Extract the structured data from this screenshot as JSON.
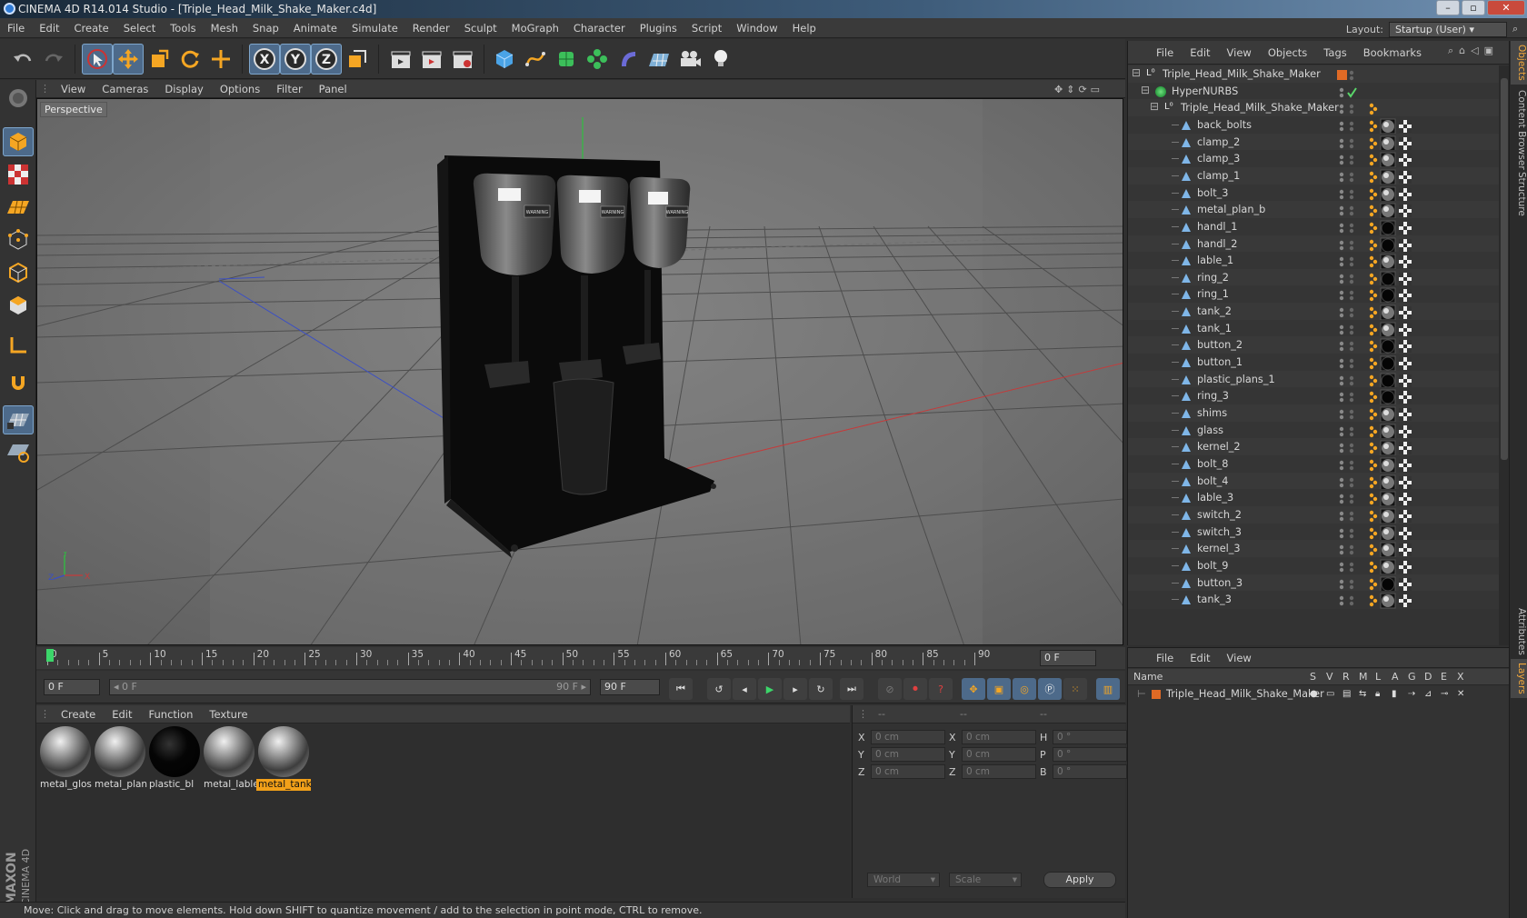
{
  "window": {
    "title": "CINEMA 4D R14.014 Studio - [Triple_Head_Milk_Shake_Maker.c4d]"
  },
  "menubar": [
    "File",
    "Edit",
    "Create",
    "Select",
    "Tools",
    "Mesh",
    "Snap",
    "Animate",
    "Simulate",
    "Render",
    "Sculpt",
    "MoGraph",
    "Character",
    "Plugins",
    "Script",
    "Window",
    "Help"
  ],
  "layout": {
    "label": "Layout:",
    "value": "Startup (User)"
  },
  "viewport": {
    "menu": [
      "View",
      "Cameras",
      "Display",
      "Options",
      "Filter",
      "Panel"
    ],
    "label": "Perspective",
    "axis": {
      "x": "X",
      "y": "Y",
      "z": "Z"
    },
    "warning_labels": [
      "WARNING",
      "WARNING",
      "WARNING"
    ]
  },
  "timeline": {
    "ticks": [
      "0",
      "5",
      "10",
      "15",
      "20",
      "25",
      "30",
      "35",
      "40",
      "45",
      "50",
      "55",
      "60",
      "65",
      "70",
      "75",
      "80",
      "85",
      "90"
    ],
    "current_frame": "0 F",
    "start_frame": "0 F",
    "range_start": "0 F",
    "range_end": "90 F",
    "end_frame": "90 F"
  },
  "material_manager": {
    "menu": [
      "Create",
      "Edit",
      "Function",
      "Texture"
    ],
    "materials": [
      {
        "name": "metal_glos",
        "selected": false,
        "kind": "metal"
      },
      {
        "name": "metal_plan",
        "selected": false,
        "kind": "metal"
      },
      {
        "name": "plastic_bl",
        "selected": false,
        "kind": "black"
      },
      {
        "name": "metal_lable",
        "selected": false,
        "kind": "metal"
      },
      {
        "name": "metal_tank",
        "selected": true,
        "kind": "metal"
      }
    ]
  },
  "coordinates": {
    "header": [
      "--",
      "--",
      "--"
    ],
    "rows": [
      {
        "a": "X",
        "av": "0 cm",
        "b": "X",
        "bv": "0 cm",
        "c": "H",
        "cv": "0 °"
      },
      {
        "a": "Y",
        "av": "0 cm",
        "b": "Y",
        "bv": "0 cm",
        "c": "P",
        "cv": "0 °"
      },
      {
        "a": "Z",
        "av": "0 cm",
        "b": "Z",
        "bv": "0 cm",
        "c": "B",
        "cv": "0 °"
      }
    ],
    "space": "World",
    "mode": "Scale",
    "apply": "Apply"
  },
  "status": "Move: Click and drag to move elements. Hold down SHIFT to quantize movement / add to the selection in point mode, CTRL to remove.",
  "objects_panel": {
    "menu": [
      "File",
      "Edit",
      "View",
      "Objects",
      "Tags",
      "Bookmarks"
    ],
    "items": [
      {
        "name": "Triple_Head_Milk_Shake_Maker",
        "level": 0,
        "type": "null"
      },
      {
        "name": "HyperNURBS",
        "level": 1,
        "type": "nurbs"
      },
      {
        "name": "Triple_Head_Milk_Shake_Maker",
        "level": 2,
        "type": "null"
      },
      {
        "name": "back_bolts",
        "level": 3,
        "type": "poly"
      },
      {
        "name": "clamp_2",
        "level": 3,
        "type": "poly"
      },
      {
        "name": "clamp_3",
        "level": 3,
        "type": "poly"
      },
      {
        "name": "clamp_1",
        "level": 3,
        "type": "poly"
      },
      {
        "name": "bolt_3",
        "level": 3,
        "type": "poly"
      },
      {
        "name": "metal_plan_b",
        "level": 3,
        "type": "poly"
      },
      {
        "name": "handl_1",
        "level": 3,
        "type": "poly",
        "mat": "black"
      },
      {
        "name": "handl_2",
        "level": 3,
        "type": "poly",
        "mat": "black"
      },
      {
        "name": "lable_1",
        "level": 3,
        "type": "poly"
      },
      {
        "name": "ring_2",
        "level": 3,
        "type": "poly",
        "mat": "black"
      },
      {
        "name": "ring_1",
        "level": 3,
        "type": "poly",
        "mat": "black"
      },
      {
        "name": "tank_2",
        "level": 3,
        "type": "poly"
      },
      {
        "name": "tank_1",
        "level": 3,
        "type": "poly"
      },
      {
        "name": "button_2",
        "level": 3,
        "type": "poly",
        "mat": "black"
      },
      {
        "name": "button_1",
        "level": 3,
        "type": "poly",
        "mat": "black"
      },
      {
        "name": "plastic_plans_1",
        "level": 3,
        "type": "poly",
        "mat": "black"
      },
      {
        "name": "ring_3",
        "level": 3,
        "type": "poly",
        "mat": "black"
      },
      {
        "name": "shims",
        "level": 3,
        "type": "poly"
      },
      {
        "name": "glass",
        "level": 3,
        "type": "poly"
      },
      {
        "name": "kernel_2",
        "level": 3,
        "type": "poly"
      },
      {
        "name": "bolt_8",
        "level": 3,
        "type": "poly"
      },
      {
        "name": "bolt_4",
        "level": 3,
        "type": "poly"
      },
      {
        "name": "lable_3",
        "level": 3,
        "type": "poly"
      },
      {
        "name": "switch_2",
        "level": 3,
        "type": "poly"
      },
      {
        "name": "switch_3",
        "level": 3,
        "type": "poly"
      },
      {
        "name": "kernel_3",
        "level": 3,
        "type": "poly"
      },
      {
        "name": "bolt_9",
        "level": 3,
        "type": "poly"
      },
      {
        "name": "button_3",
        "level": 3,
        "type": "poly",
        "mat": "black"
      },
      {
        "name": "tank_3",
        "level": 3,
        "type": "poly"
      }
    ]
  },
  "layers_panel": {
    "menu": [
      "File",
      "Edit",
      "View"
    ],
    "columns": {
      "name": "Name",
      "flags": [
        "S",
        "V",
        "R",
        "M",
        "L",
        "A",
        "G",
        "D",
        "E",
        "X"
      ]
    },
    "layer_name": "Triple_Head_Milk_Shake_Maker",
    "layer_color": "#e06a25"
  },
  "right_tabs": [
    {
      "label": "Objects",
      "active": true
    },
    {
      "label": "Content Browser",
      "active": false
    },
    {
      "label": "Structure",
      "active": false
    },
    {
      "label": "Attributes",
      "active": false
    },
    {
      "label": "Layers",
      "active": true
    }
  ],
  "colors": {
    "accent": "#f2a019",
    "selection_blue": "#4d6a8a",
    "x_axis": "#c43b3b",
    "y_axis": "#2fbf3f",
    "z_axis": "#3b4fc4"
  }
}
